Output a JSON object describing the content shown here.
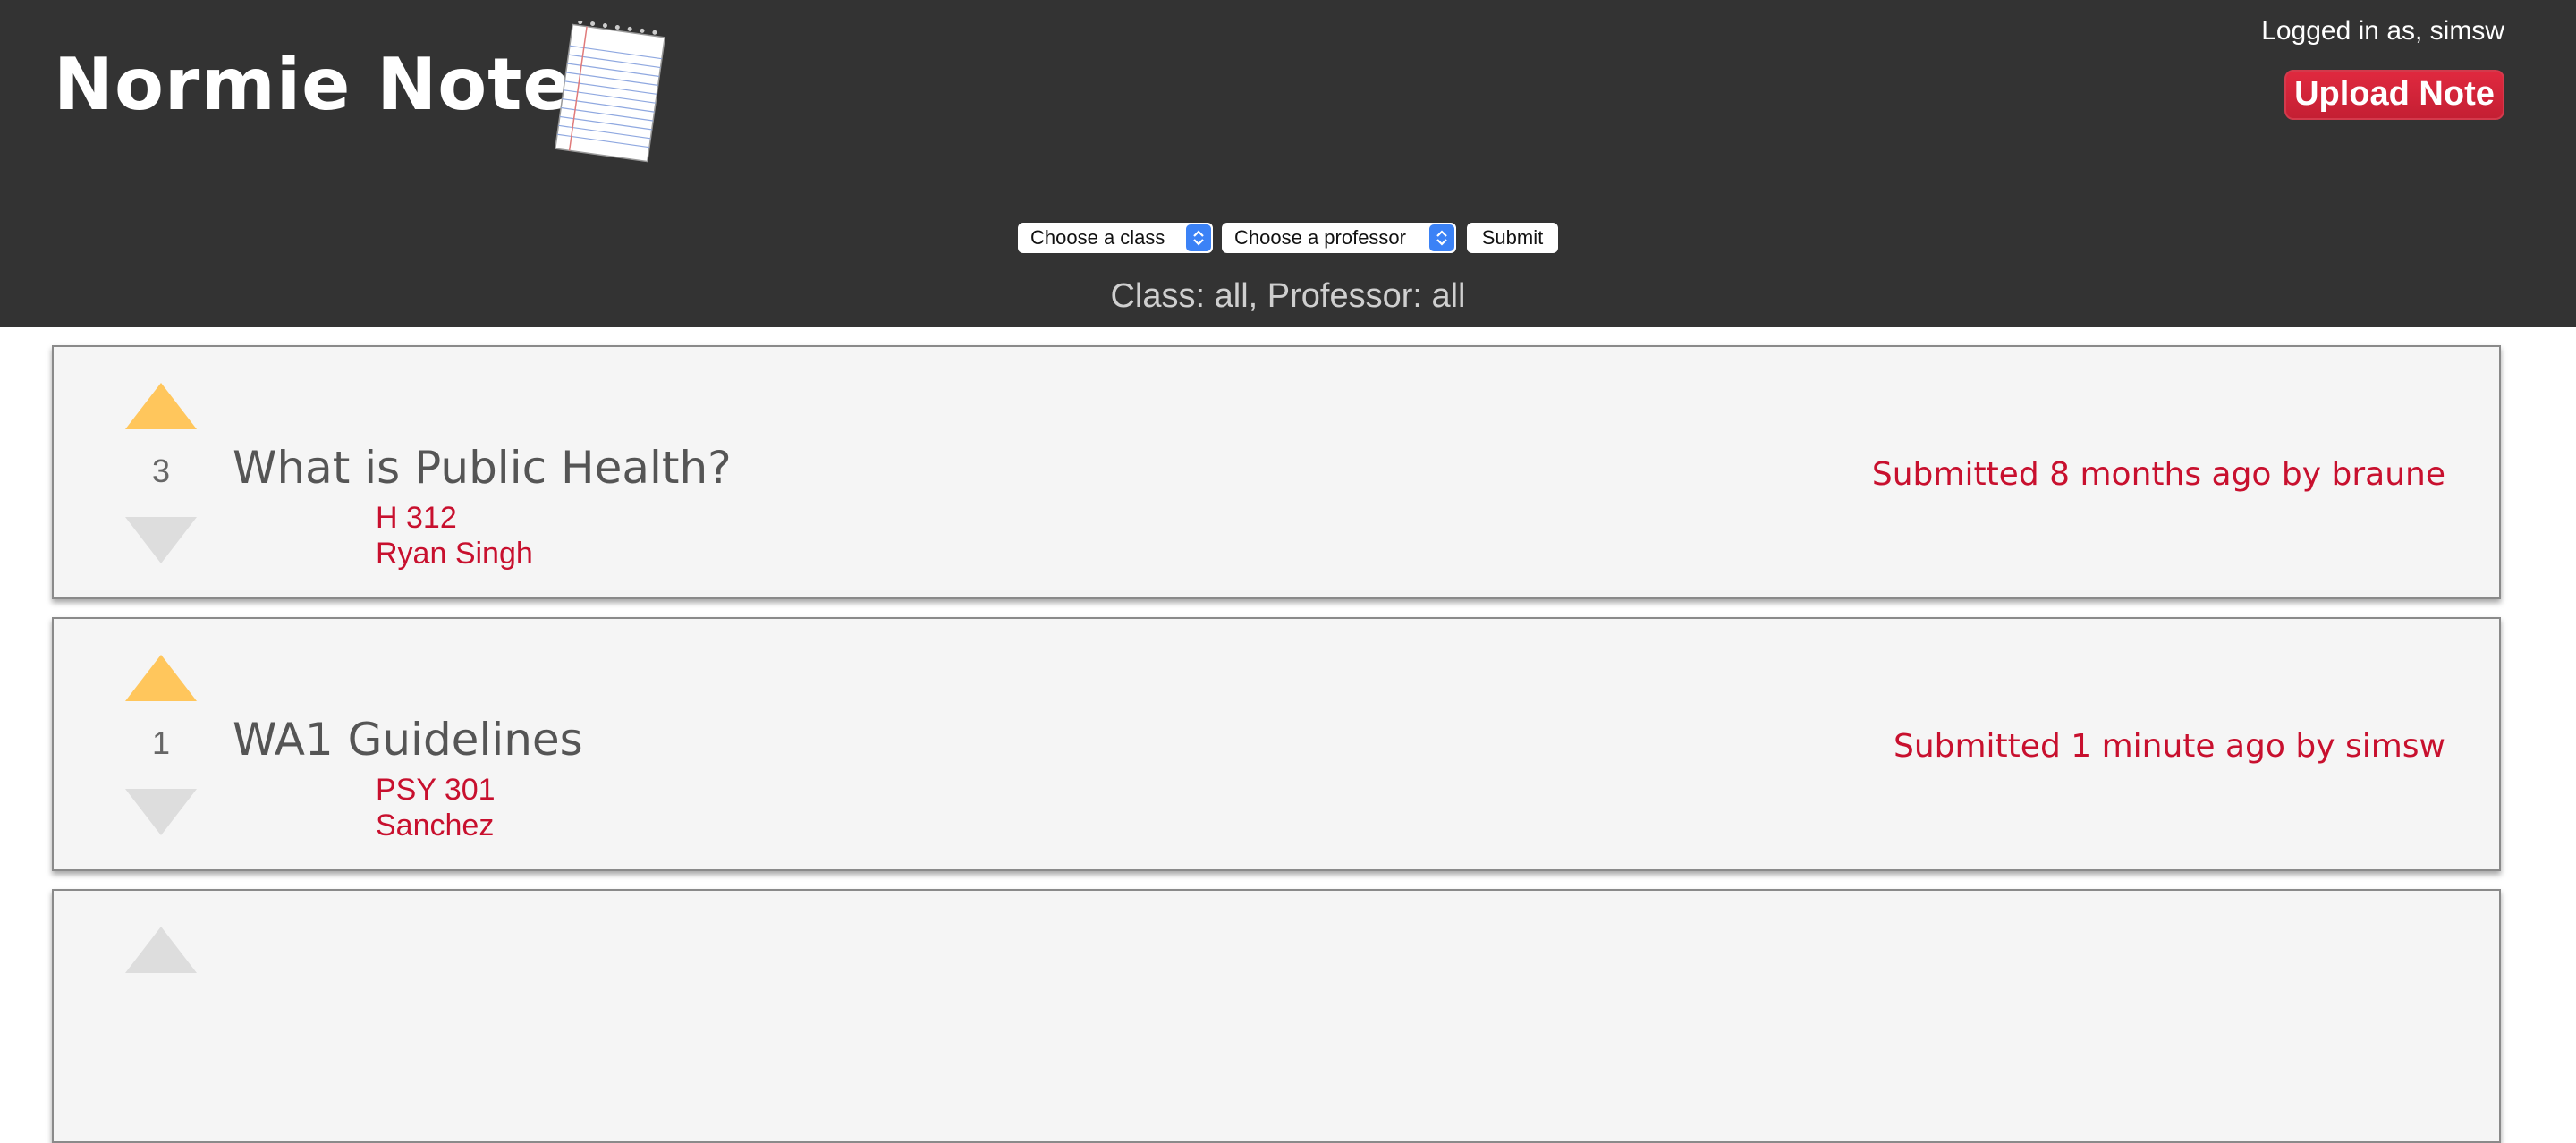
{
  "header": {
    "site_title": "Normie Notes",
    "logged_in_text": "Logged in as, simsw",
    "upload_label": "Upload Note"
  },
  "filters": {
    "class_select_value": "Choose a class",
    "professor_select_value": "Choose a professor",
    "submit_label": "Submit",
    "status_text": "Class: all, Professor: all"
  },
  "notes": [
    {
      "votes": "3",
      "title": "What is Public Health?",
      "class": "H 312",
      "professor": "Ryan Singh",
      "submitted": "Submitted 8 months ago by braune",
      "upvote_active": true
    },
    {
      "votes": "1",
      "title": "WA1 Guidelines",
      "class": "PSY 301",
      "professor": "Sanchez",
      "submitted": "Submitted 1 minute ago by simsw",
      "upvote_active": true
    },
    {
      "votes": "",
      "title": "",
      "class": "",
      "professor": "",
      "submitted": "",
      "upvote_active": false
    }
  ],
  "colors": {
    "header_bg": "#333333",
    "accent_red": "#c8102e",
    "upvote_active": "#ffc65c",
    "vote_inactive": "#dddddd"
  }
}
